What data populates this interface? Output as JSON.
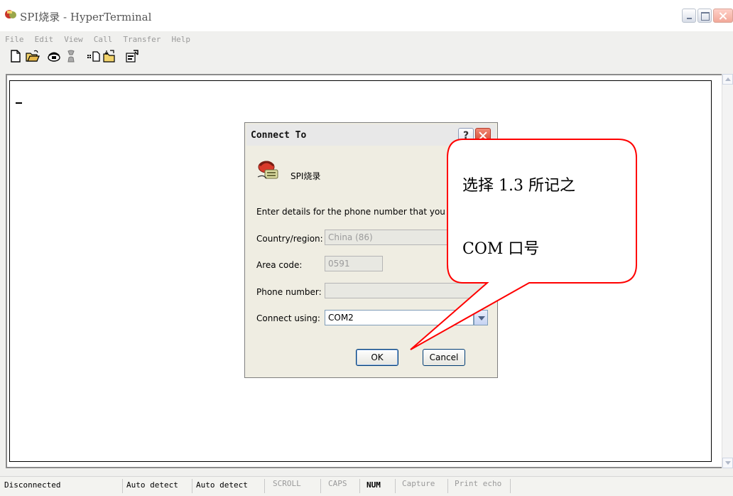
{
  "window": {
    "title": "SPI烧录 - HyperTerminal",
    "menu": [
      "File",
      "Edit",
      "View",
      "Call",
      "Transfer",
      "Help"
    ]
  },
  "toolbar": {
    "icons": [
      "new-icon",
      "open-icon",
      "call-icon",
      "disconnect-icon",
      "send-icon",
      "receive-icon",
      "properties-icon"
    ]
  },
  "statusbar": {
    "connection": "Disconnected",
    "detect1": "Auto detect",
    "detect2": "Auto detect",
    "scroll": "SCROLL",
    "caps": "CAPS",
    "num": "NUM",
    "capture": "Capture",
    "print_echo": "Print echo"
  },
  "dialog": {
    "title": "Connect To",
    "help_label": "?",
    "connection_name": "SPI烧录",
    "instruction": "Enter details for the phone number that you war",
    "country_label": "Country/region:",
    "country_value": "China (86)",
    "area_label": "Area code:",
    "area_value": "0591",
    "phone_label": "Phone number:",
    "phone_value": "",
    "connect_label": "Connect using:",
    "connect_value": "COM2",
    "ok_label": "OK",
    "cancel_label": "Cancel"
  },
  "callout": {
    "line1": "选择 1.3 所记之",
    "line2": "COM 口号",
    "border_color": "#ff0000"
  }
}
